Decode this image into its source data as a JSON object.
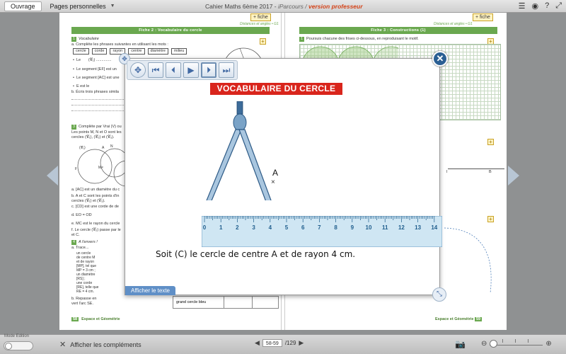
{
  "topbar": {
    "tab_ouvrage": "Ouvrage",
    "tab_pages": "Pages personnelles",
    "title_main": "Cahier Maths 6ème 2017 - ",
    "title_ip": "iParcours",
    "title_sep": " / ",
    "title_prof": "version professeur"
  },
  "left_page": {
    "fiche": "+ fiche",
    "banner": "Fiche 2 : Vocabulaire du cercle",
    "ex1_num": "1",
    "ex1_title": "Vocabulaire",
    "ex1_a": "a. Complète les phrases suivantes en utilisant les mots :",
    "words": [
      "cercle",
      "corde",
      "rayon",
      "centre",
      "diamètre",
      "milieu"
    ],
    "line_le": "Le",
    "line_c1": "(𝒞₁) ..............",
    "line_ef": "Le segment [EF] est un",
    "line_ac": "Le segment [AC] est une",
    "line_e": "E est le",
    "ex1_b": "b. Écris trois phrases simila",
    "ex3_num": "3",
    "ex3_title": "Complète par Vrai (V) ou",
    "ex3_text": "Les points M, N et O sont les\ncercles (𝒞₁), (𝒞₂) et (𝒞₃).",
    "q_a": "a. [AC] est un diamètre du c",
    "q_b": "b. A et C sont les points d'in\ncercles (𝒞₁) et (𝒞₃).",
    "q_c": "c. [CD] est une corde de de",
    "q_d": "d. EO = OD",
    "q_e": "e. MC est le rayon du cercle",
    "q_f": "f. Le cercle (𝒞₂) passe par le\net C.",
    "ex4_num": "4",
    "ex4_title": "A l'envers !",
    "ex4_a": "a. Trace...",
    "ex4_items": "un cercle\nde centre M\net de rayon\n[MP], tel que\nMP = 3 cm ;\nun diamètre\n[RS] ;\nune corde\n[RE], telle que\nRE = 4 cm.",
    "ex4_b": "b. Repasse en\nvert l'arc",
    "ex4_arc": "SE.",
    "grand_cercle": "grand cercle bleu",
    "footer_num": "58",
    "footer_txt": "Espace et Géométrie"
  },
  "right_page": {
    "fiche": "+ fiche",
    "section_tag": "Distances et angles • G1",
    "banner": "Fiche 3 : Constructions (1)",
    "ex1_num": "1",
    "ex1_text": "Poursuis chacune des frises ci-dessous, en reproduisant le motif.",
    "label_b": "B",
    "label_i": "I",
    "footer_txt": "Espace et Géométrie",
    "footer_num": "59",
    "left_tag": "Distances et angles • G1"
  },
  "modal": {
    "title": "VOCABULAIRE DU CERCLE",
    "point_label": "A",
    "ruler_numbers": [
      "0",
      "1",
      "2",
      "3",
      "4",
      "5",
      "6",
      "7",
      "8",
      "9",
      "10",
      "11",
      "12",
      "13",
      "14"
    ],
    "caption": "Soit (C) le cercle de centre A et de rayon 4 cm.",
    "show_text": "Afficher le texte",
    "controls": [
      "move-icon",
      "skip-start-icon",
      "step-back-icon",
      "play-icon",
      "step-forward-icon",
      "skip-end-icon"
    ]
  },
  "bottombar": {
    "mode_label": "Mode Edition",
    "complements": "Afficher les compléments",
    "page_range": "58-59",
    "page_total": "/129"
  },
  "colors": {
    "accent_green": "#6aa84f",
    "title_red": "#d9251c",
    "control_blue": "#4169a3",
    "prof_orange": "#d4451b"
  }
}
